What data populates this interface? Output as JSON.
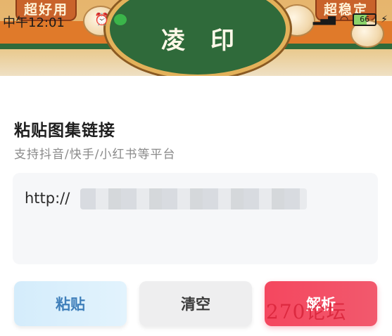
{
  "banner": {
    "ribbon_left": "超好用",
    "ribbon_right": "超稳定",
    "app_title": "凌印"
  },
  "status_bar": {
    "time": "中午12:01",
    "battery": "66"
  },
  "card": {
    "title": "粘贴图集链接",
    "subtitle": "支持抖音/快手/小红书等平台",
    "url_prefix": "http://"
  },
  "buttons": {
    "paste": "粘贴",
    "clear": "清空",
    "parse": "解析"
  },
  "watermark": "270论坛",
  "colors": {
    "paste_bg": "#d4ecfb",
    "paste_text": "#3f7fba",
    "clear_bg": "#eeeeef",
    "parse_bg": "#f4475f",
    "banner_green": "#2f6a3a",
    "banner_orange": "#e07a2a"
  },
  "icons": [
    "alarm-icon",
    "wechat-icon",
    "signal-icon",
    "wifi-icon",
    "battery-icon",
    "charging-icon"
  ]
}
